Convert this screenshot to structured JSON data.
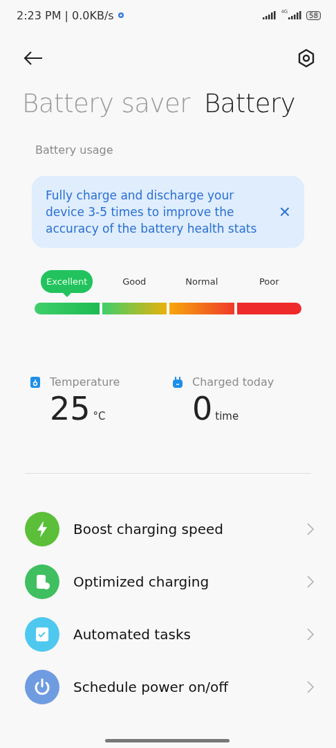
{
  "status_bar": {
    "time": "2:23 PM | 0.0KB/s",
    "network": "4G",
    "battery": "58"
  },
  "tabs": [
    {
      "label": "Battery saver",
      "selected": false
    },
    {
      "label": "Battery",
      "selected": true
    }
  ],
  "section_title": "Battery usage",
  "tip": {
    "text": "Fully charge and discharge your device 3-5 times to improve the accuracy of the battery health stats",
    "close": "×"
  },
  "health_levels": [
    {
      "label": "Excellent",
      "selected": true
    },
    {
      "label": "Good",
      "selected": false
    },
    {
      "label": "Normal",
      "selected": false
    },
    {
      "label": "Poor",
      "selected": false
    }
  ],
  "stats": [
    {
      "kind": "temperature",
      "label": "Temperature",
      "value": "25",
      "unit": "°C"
    },
    {
      "kind": "charges",
      "label": "Charged today",
      "value": "0",
      "unit": "time"
    }
  ],
  "menu": [
    {
      "kind": "boost",
      "label": "Boost charging speed",
      "color": "#5bbf3a"
    },
    {
      "kind": "optimized",
      "label": "Optimized charging",
      "color": "#3fbf5f"
    },
    {
      "kind": "tasks",
      "label": "Automated tasks",
      "color": "#4fc8ef"
    },
    {
      "kind": "power",
      "label": "Schedule power on/off",
      "color": "#6f9be0"
    }
  ]
}
